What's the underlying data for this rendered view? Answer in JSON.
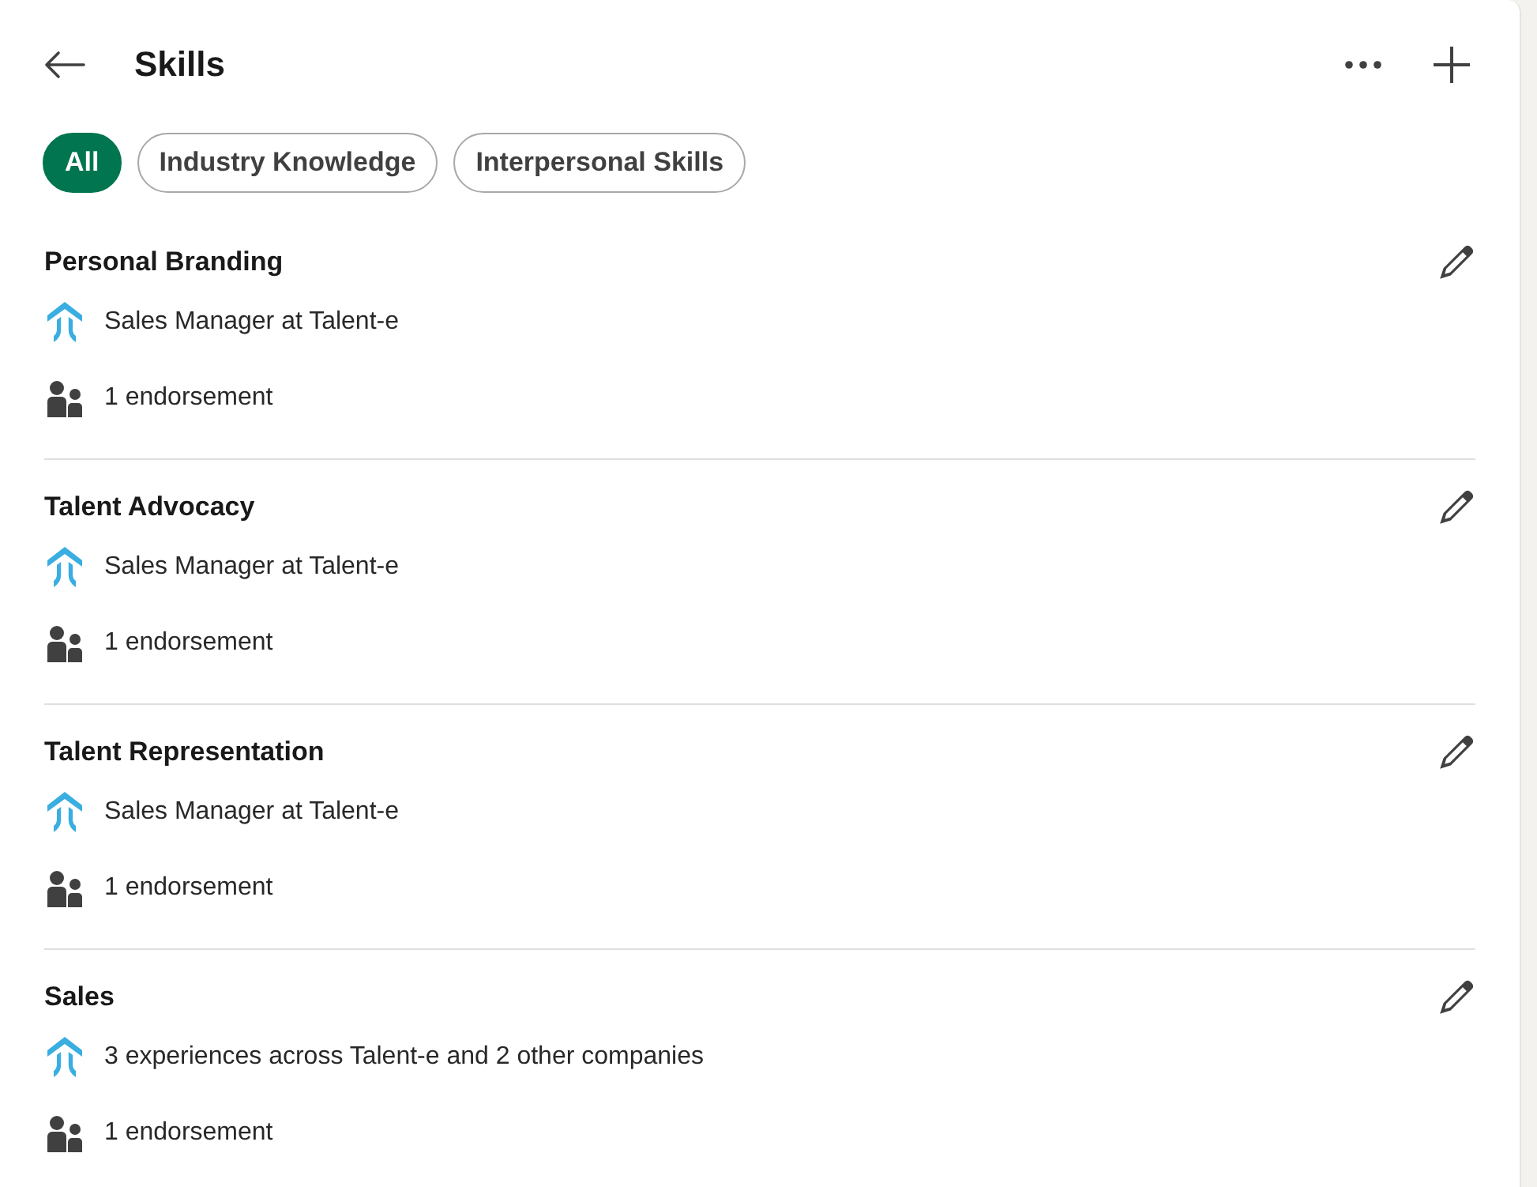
{
  "header": {
    "title": "Skills"
  },
  "filters": [
    {
      "label": "All",
      "selected": true
    },
    {
      "label": "Industry Knowledge",
      "selected": false
    },
    {
      "label": "Interpersonal Skills",
      "selected": false
    }
  ],
  "skills": [
    {
      "name": "Personal Branding",
      "experience": "Sales Manager at Talent-e",
      "endorsements": "1 endorsement"
    },
    {
      "name": "Talent Advocacy",
      "experience": "Sales Manager at Talent-e",
      "endorsements": "1 endorsement"
    },
    {
      "name": "Talent Representation",
      "experience": "Sales Manager at Talent-e",
      "endorsements": "1 endorsement"
    },
    {
      "name": "Sales",
      "experience": "3 experiences across Talent-e and 2 other companies",
      "endorsements": "1 endorsement"
    }
  ]
}
